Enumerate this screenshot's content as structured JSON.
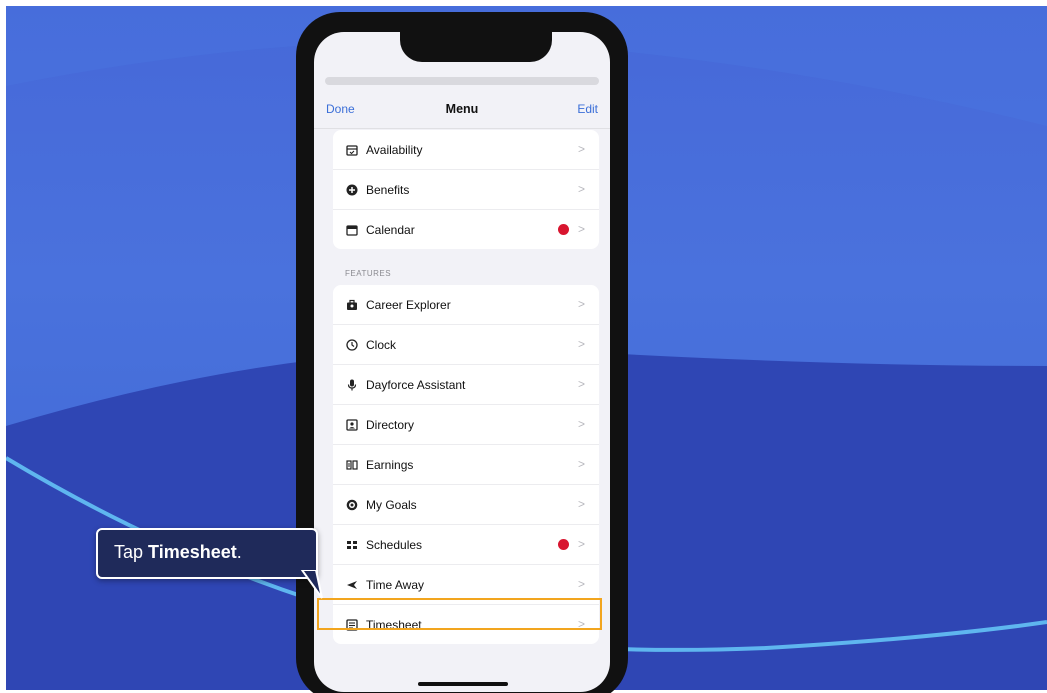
{
  "nav": {
    "left": "Done",
    "title": "Menu",
    "right": "Edit"
  },
  "group1": [
    {
      "label": "Availability",
      "icon": "calendar-check-icon",
      "dot": false
    },
    {
      "label": "Benefits",
      "icon": "plus-circle-icon",
      "dot": false
    },
    {
      "label": "Calendar",
      "icon": "calendar-icon",
      "dot": true
    }
  ],
  "features_header": "FEATURES",
  "features": [
    {
      "label": "Career Explorer",
      "icon": "briefcase-icon",
      "dot": false
    },
    {
      "label": "Clock",
      "icon": "clock-icon",
      "dot": false
    },
    {
      "label": "Dayforce Assistant",
      "icon": "microphone-icon",
      "dot": false
    },
    {
      "label": "Directory",
      "icon": "directory-icon",
      "dot": false
    },
    {
      "label": "Earnings",
      "icon": "earnings-icon",
      "dot": false
    },
    {
      "label": "My Goals",
      "icon": "target-icon",
      "dot": false
    },
    {
      "label": "Schedules",
      "icon": "schedule-icon",
      "dot": true
    },
    {
      "label": "Time Away",
      "icon": "airplane-icon",
      "dot": false
    },
    {
      "label": "Timesheet",
      "icon": "timesheet-icon",
      "dot": false
    }
  ],
  "callout": {
    "prefix": "Tap ",
    "bold": "Timesheet",
    "suffix": "."
  },
  "chevron": ">",
  "colors": {
    "accent": "#3b6fd8",
    "badge": "#d8152f",
    "highlight": "#f2a51e",
    "callout_bg": "#1f2a5a"
  }
}
